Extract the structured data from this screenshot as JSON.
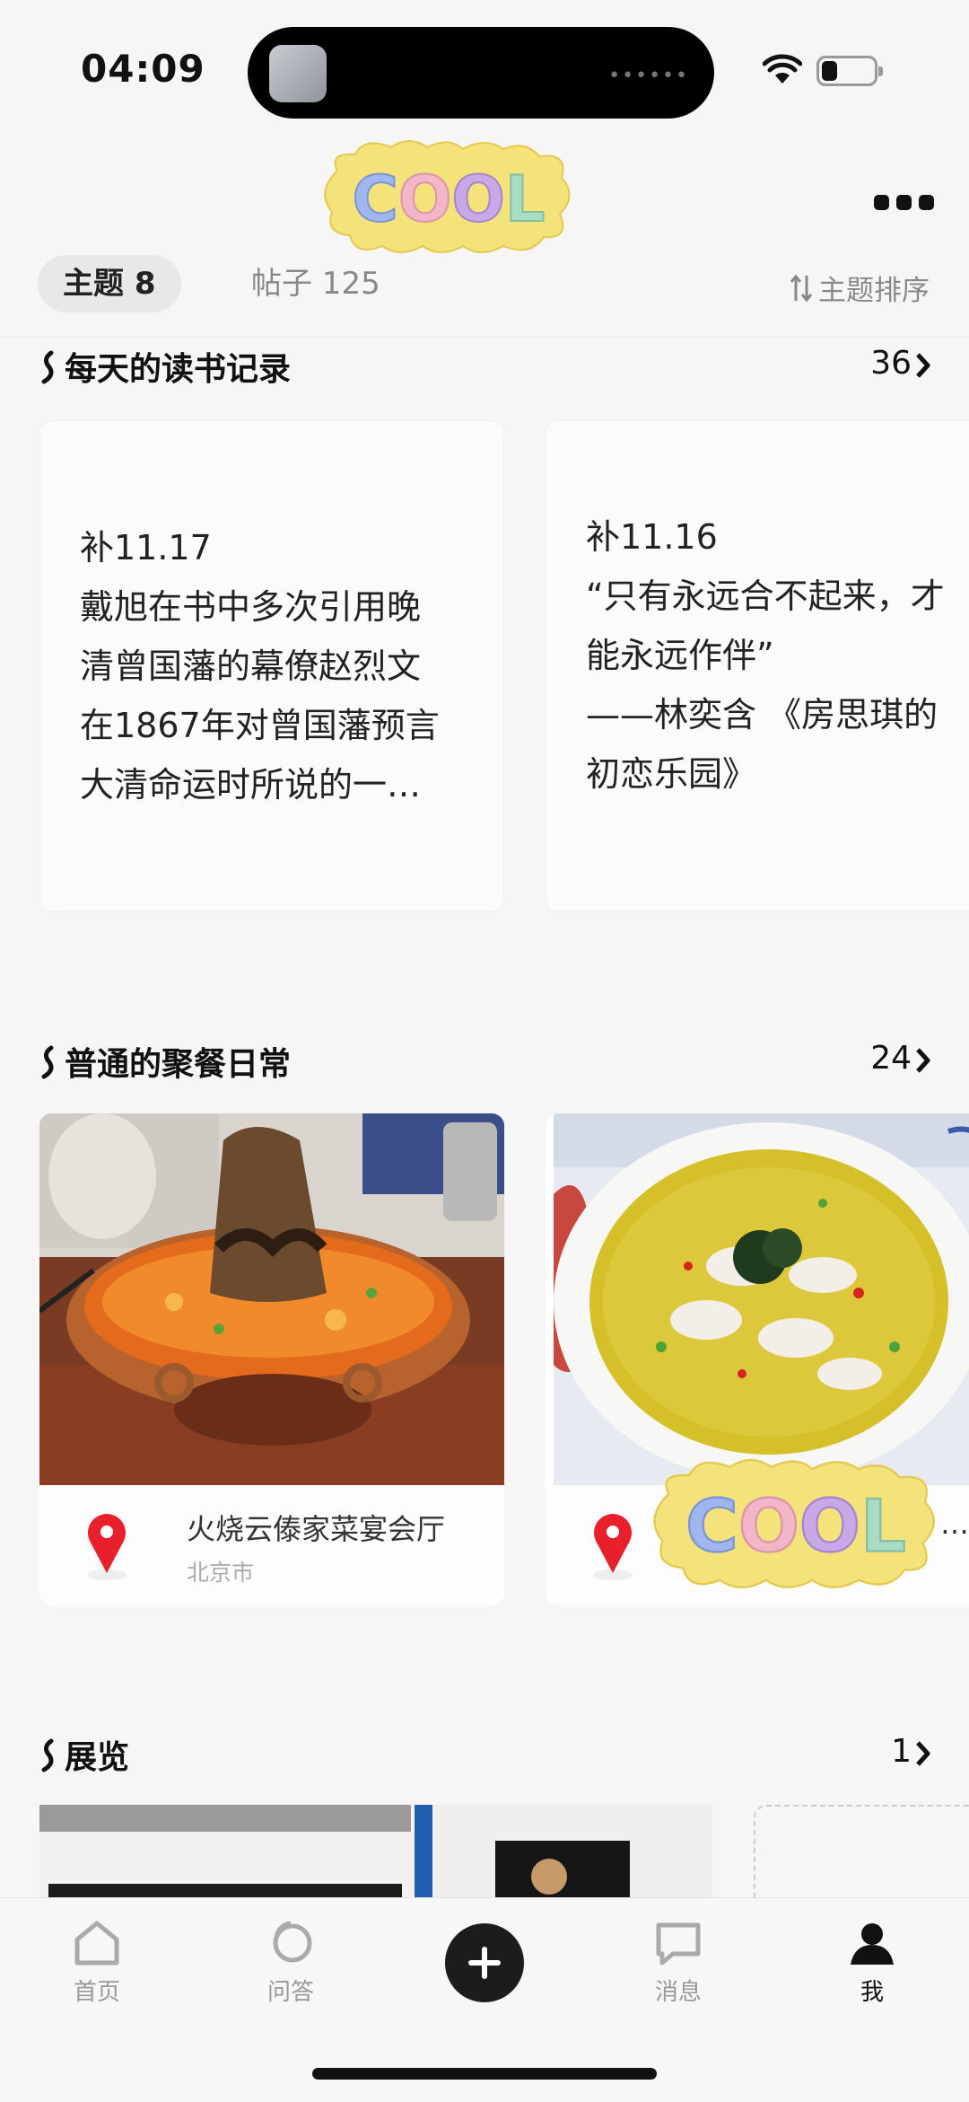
{
  "status": {
    "time": "04:09",
    "battery_level": 0.3
  },
  "header": {
    "sticker_text": "COOL",
    "more_icon": "more-dots-icon"
  },
  "tabs": {
    "topic": "主题 8",
    "posts": "帖子 125",
    "sort": "主题排序"
  },
  "sections": {
    "reading": {
      "title": "每天的读书记录",
      "count": "36",
      "cards": [
        "补11.17\n戴旭在书中多次引用晚\n清曾国藩的幕僚赵烈文\n在1867年对曾国藩预言\n大清命运时所说的一…",
        "补11.16\n“只有永远合不起来，才\n能永远作伴”\n——林奕含 《房思琪的\n初恋乐园》"
      ]
    },
    "dining": {
      "title": "普通的聚餐日常",
      "count": "24",
      "cards": [
        {
          "place": "火烧云傣家菜宴会厅",
          "city": "北京市"
        },
        {
          "place": "…",
          "city": ""
        }
      ]
    },
    "exhibition": {
      "title": "展览",
      "count": "1"
    }
  },
  "bottom_nav": {
    "home": "首页",
    "qa": "问答",
    "messages": "消息",
    "me": "我"
  },
  "colors": {
    "pin_red": "#e8202b",
    "sticker_yellow": "#f4e27a"
  }
}
